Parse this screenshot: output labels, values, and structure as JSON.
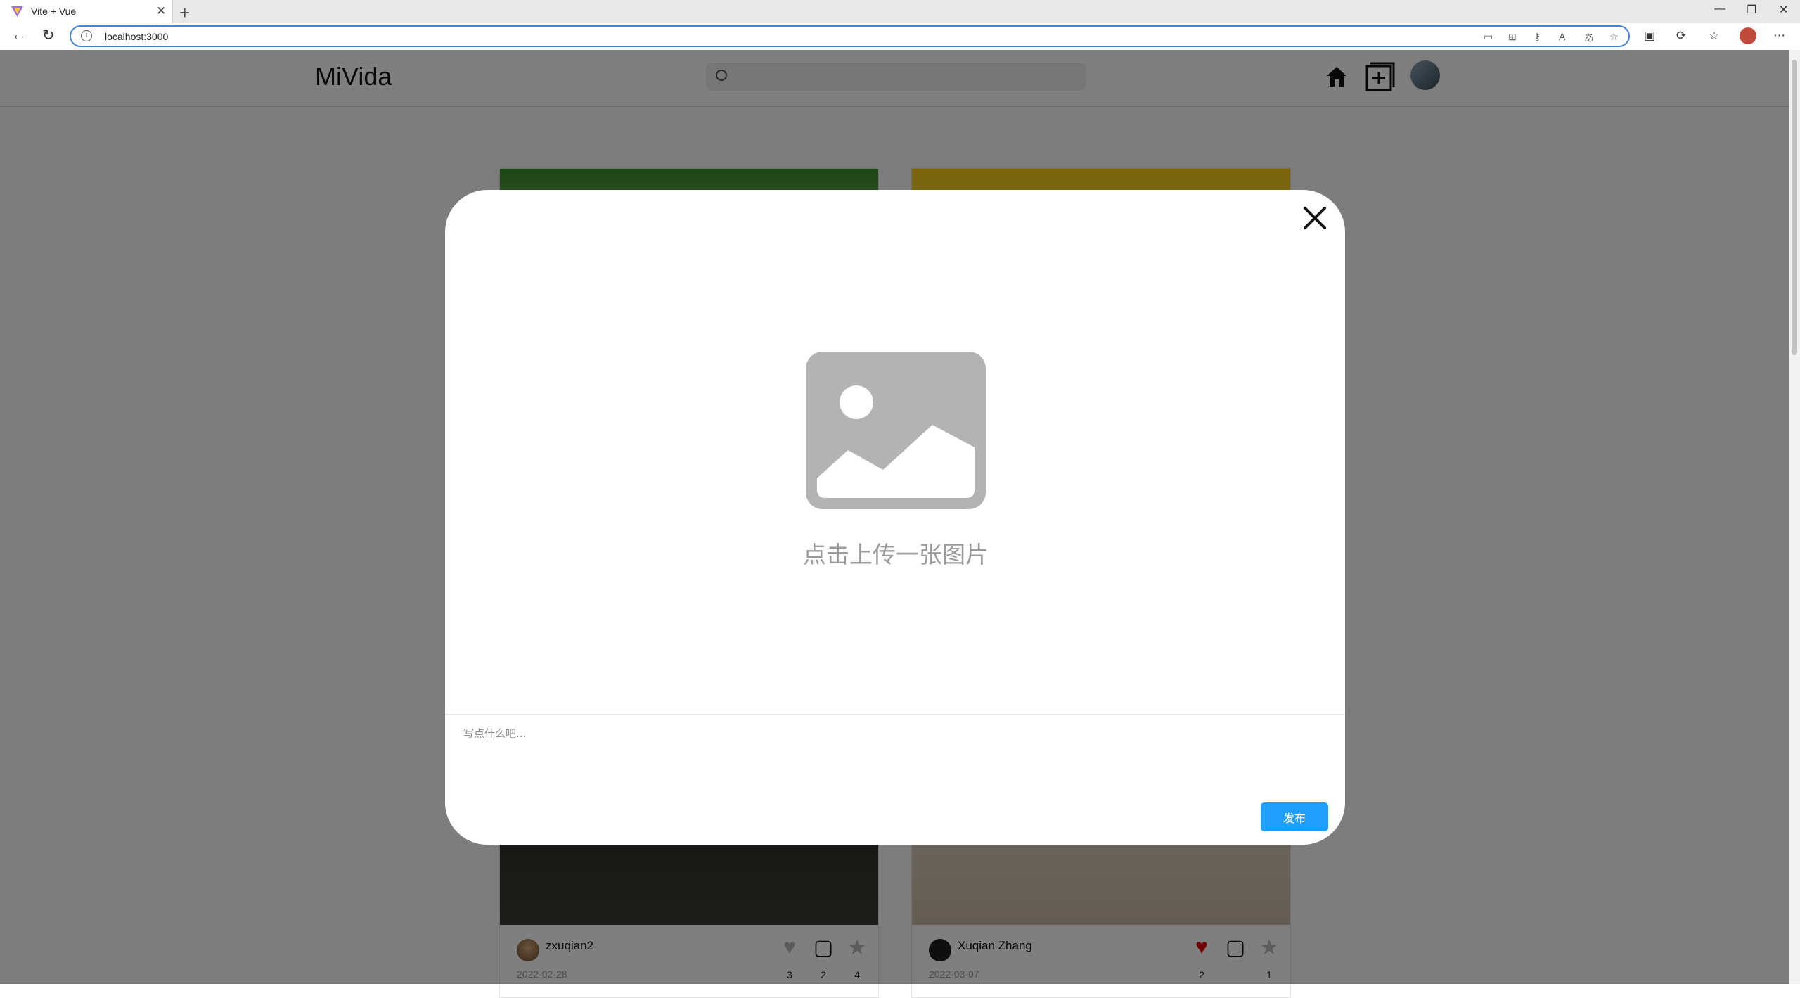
{
  "browser": {
    "tab_title": "Vite + Vue",
    "tab_close": "✕",
    "new_tab": "+",
    "url": "localhost:3000",
    "window_controls": [
      "—",
      "❐",
      "✕"
    ]
  },
  "header": {
    "logo": "MiVida",
    "search": {
      "placeholder": ""
    },
    "icons": [
      "home-icon",
      "new-post-icon",
      "avatar"
    ]
  },
  "feed": [
    {
      "username": "zxuqian2",
      "date": "2022-02-28",
      "likes": "3",
      "comments": "2",
      "favorites": "4",
      "liked": false
    },
    {
      "username": "Xuqian Zhang",
      "date": "2022-03-07",
      "likes": "2",
      "comments": "",
      "favorites": "1",
      "liked": true
    }
  ],
  "modal": {
    "upload_label": "点击上传一张图片",
    "caption_placeholder": "写点什么吧...",
    "publish_label": "发布"
  },
  "colors": {
    "accent": "#1e9fff",
    "like_active": "#e00000",
    "placeholder_icon": "#b3b3b3"
  }
}
